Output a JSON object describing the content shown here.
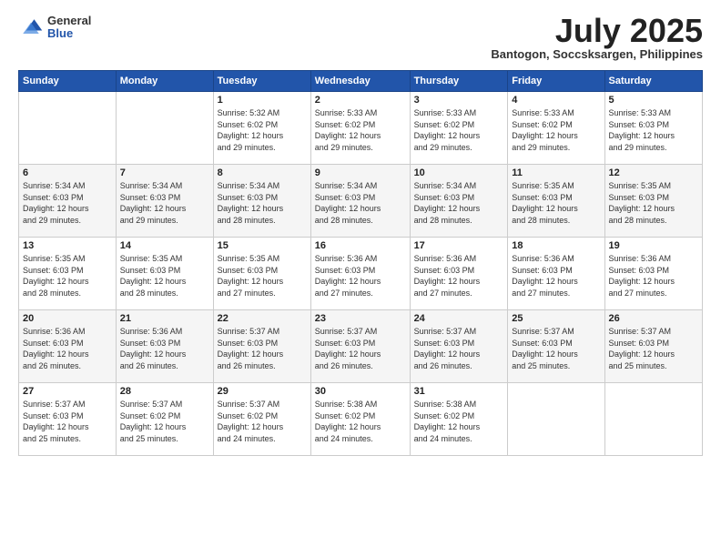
{
  "logo": {
    "general": "General",
    "blue": "Blue"
  },
  "header": {
    "month": "July 2025",
    "location": "Bantogon, Soccsksargen, Philippines"
  },
  "weekdays": [
    "Sunday",
    "Monday",
    "Tuesday",
    "Wednesday",
    "Thursday",
    "Friday",
    "Saturday"
  ],
  "weeks": [
    [
      {
        "day": "",
        "content": ""
      },
      {
        "day": "",
        "content": ""
      },
      {
        "day": "1",
        "content": "Sunrise: 5:32 AM\nSunset: 6:02 PM\nDaylight: 12 hours\nand 29 minutes."
      },
      {
        "day": "2",
        "content": "Sunrise: 5:33 AM\nSunset: 6:02 PM\nDaylight: 12 hours\nand 29 minutes."
      },
      {
        "day": "3",
        "content": "Sunrise: 5:33 AM\nSunset: 6:02 PM\nDaylight: 12 hours\nand 29 minutes."
      },
      {
        "day": "4",
        "content": "Sunrise: 5:33 AM\nSunset: 6:02 PM\nDaylight: 12 hours\nand 29 minutes."
      },
      {
        "day": "5",
        "content": "Sunrise: 5:33 AM\nSunset: 6:03 PM\nDaylight: 12 hours\nand 29 minutes."
      }
    ],
    [
      {
        "day": "6",
        "content": "Sunrise: 5:34 AM\nSunset: 6:03 PM\nDaylight: 12 hours\nand 29 minutes."
      },
      {
        "day": "7",
        "content": "Sunrise: 5:34 AM\nSunset: 6:03 PM\nDaylight: 12 hours\nand 29 minutes."
      },
      {
        "day": "8",
        "content": "Sunrise: 5:34 AM\nSunset: 6:03 PM\nDaylight: 12 hours\nand 28 minutes."
      },
      {
        "day": "9",
        "content": "Sunrise: 5:34 AM\nSunset: 6:03 PM\nDaylight: 12 hours\nand 28 minutes."
      },
      {
        "day": "10",
        "content": "Sunrise: 5:34 AM\nSunset: 6:03 PM\nDaylight: 12 hours\nand 28 minutes."
      },
      {
        "day": "11",
        "content": "Sunrise: 5:35 AM\nSunset: 6:03 PM\nDaylight: 12 hours\nand 28 minutes."
      },
      {
        "day": "12",
        "content": "Sunrise: 5:35 AM\nSunset: 6:03 PM\nDaylight: 12 hours\nand 28 minutes."
      }
    ],
    [
      {
        "day": "13",
        "content": "Sunrise: 5:35 AM\nSunset: 6:03 PM\nDaylight: 12 hours\nand 28 minutes."
      },
      {
        "day": "14",
        "content": "Sunrise: 5:35 AM\nSunset: 6:03 PM\nDaylight: 12 hours\nand 28 minutes."
      },
      {
        "day": "15",
        "content": "Sunrise: 5:35 AM\nSunset: 6:03 PM\nDaylight: 12 hours\nand 27 minutes."
      },
      {
        "day": "16",
        "content": "Sunrise: 5:36 AM\nSunset: 6:03 PM\nDaylight: 12 hours\nand 27 minutes."
      },
      {
        "day": "17",
        "content": "Sunrise: 5:36 AM\nSunset: 6:03 PM\nDaylight: 12 hours\nand 27 minutes."
      },
      {
        "day": "18",
        "content": "Sunrise: 5:36 AM\nSunset: 6:03 PM\nDaylight: 12 hours\nand 27 minutes."
      },
      {
        "day": "19",
        "content": "Sunrise: 5:36 AM\nSunset: 6:03 PM\nDaylight: 12 hours\nand 27 minutes."
      }
    ],
    [
      {
        "day": "20",
        "content": "Sunrise: 5:36 AM\nSunset: 6:03 PM\nDaylight: 12 hours\nand 26 minutes."
      },
      {
        "day": "21",
        "content": "Sunrise: 5:36 AM\nSunset: 6:03 PM\nDaylight: 12 hours\nand 26 minutes."
      },
      {
        "day": "22",
        "content": "Sunrise: 5:37 AM\nSunset: 6:03 PM\nDaylight: 12 hours\nand 26 minutes."
      },
      {
        "day": "23",
        "content": "Sunrise: 5:37 AM\nSunset: 6:03 PM\nDaylight: 12 hours\nand 26 minutes."
      },
      {
        "day": "24",
        "content": "Sunrise: 5:37 AM\nSunset: 6:03 PM\nDaylight: 12 hours\nand 26 minutes."
      },
      {
        "day": "25",
        "content": "Sunrise: 5:37 AM\nSunset: 6:03 PM\nDaylight: 12 hours\nand 25 minutes."
      },
      {
        "day": "26",
        "content": "Sunrise: 5:37 AM\nSunset: 6:03 PM\nDaylight: 12 hours\nand 25 minutes."
      }
    ],
    [
      {
        "day": "27",
        "content": "Sunrise: 5:37 AM\nSunset: 6:03 PM\nDaylight: 12 hours\nand 25 minutes."
      },
      {
        "day": "28",
        "content": "Sunrise: 5:37 AM\nSunset: 6:02 PM\nDaylight: 12 hours\nand 25 minutes."
      },
      {
        "day": "29",
        "content": "Sunrise: 5:37 AM\nSunset: 6:02 PM\nDaylight: 12 hours\nand 24 minutes."
      },
      {
        "day": "30",
        "content": "Sunrise: 5:38 AM\nSunset: 6:02 PM\nDaylight: 12 hours\nand 24 minutes."
      },
      {
        "day": "31",
        "content": "Sunrise: 5:38 AM\nSunset: 6:02 PM\nDaylight: 12 hours\nand 24 minutes."
      },
      {
        "day": "",
        "content": ""
      },
      {
        "day": "",
        "content": ""
      }
    ]
  ]
}
